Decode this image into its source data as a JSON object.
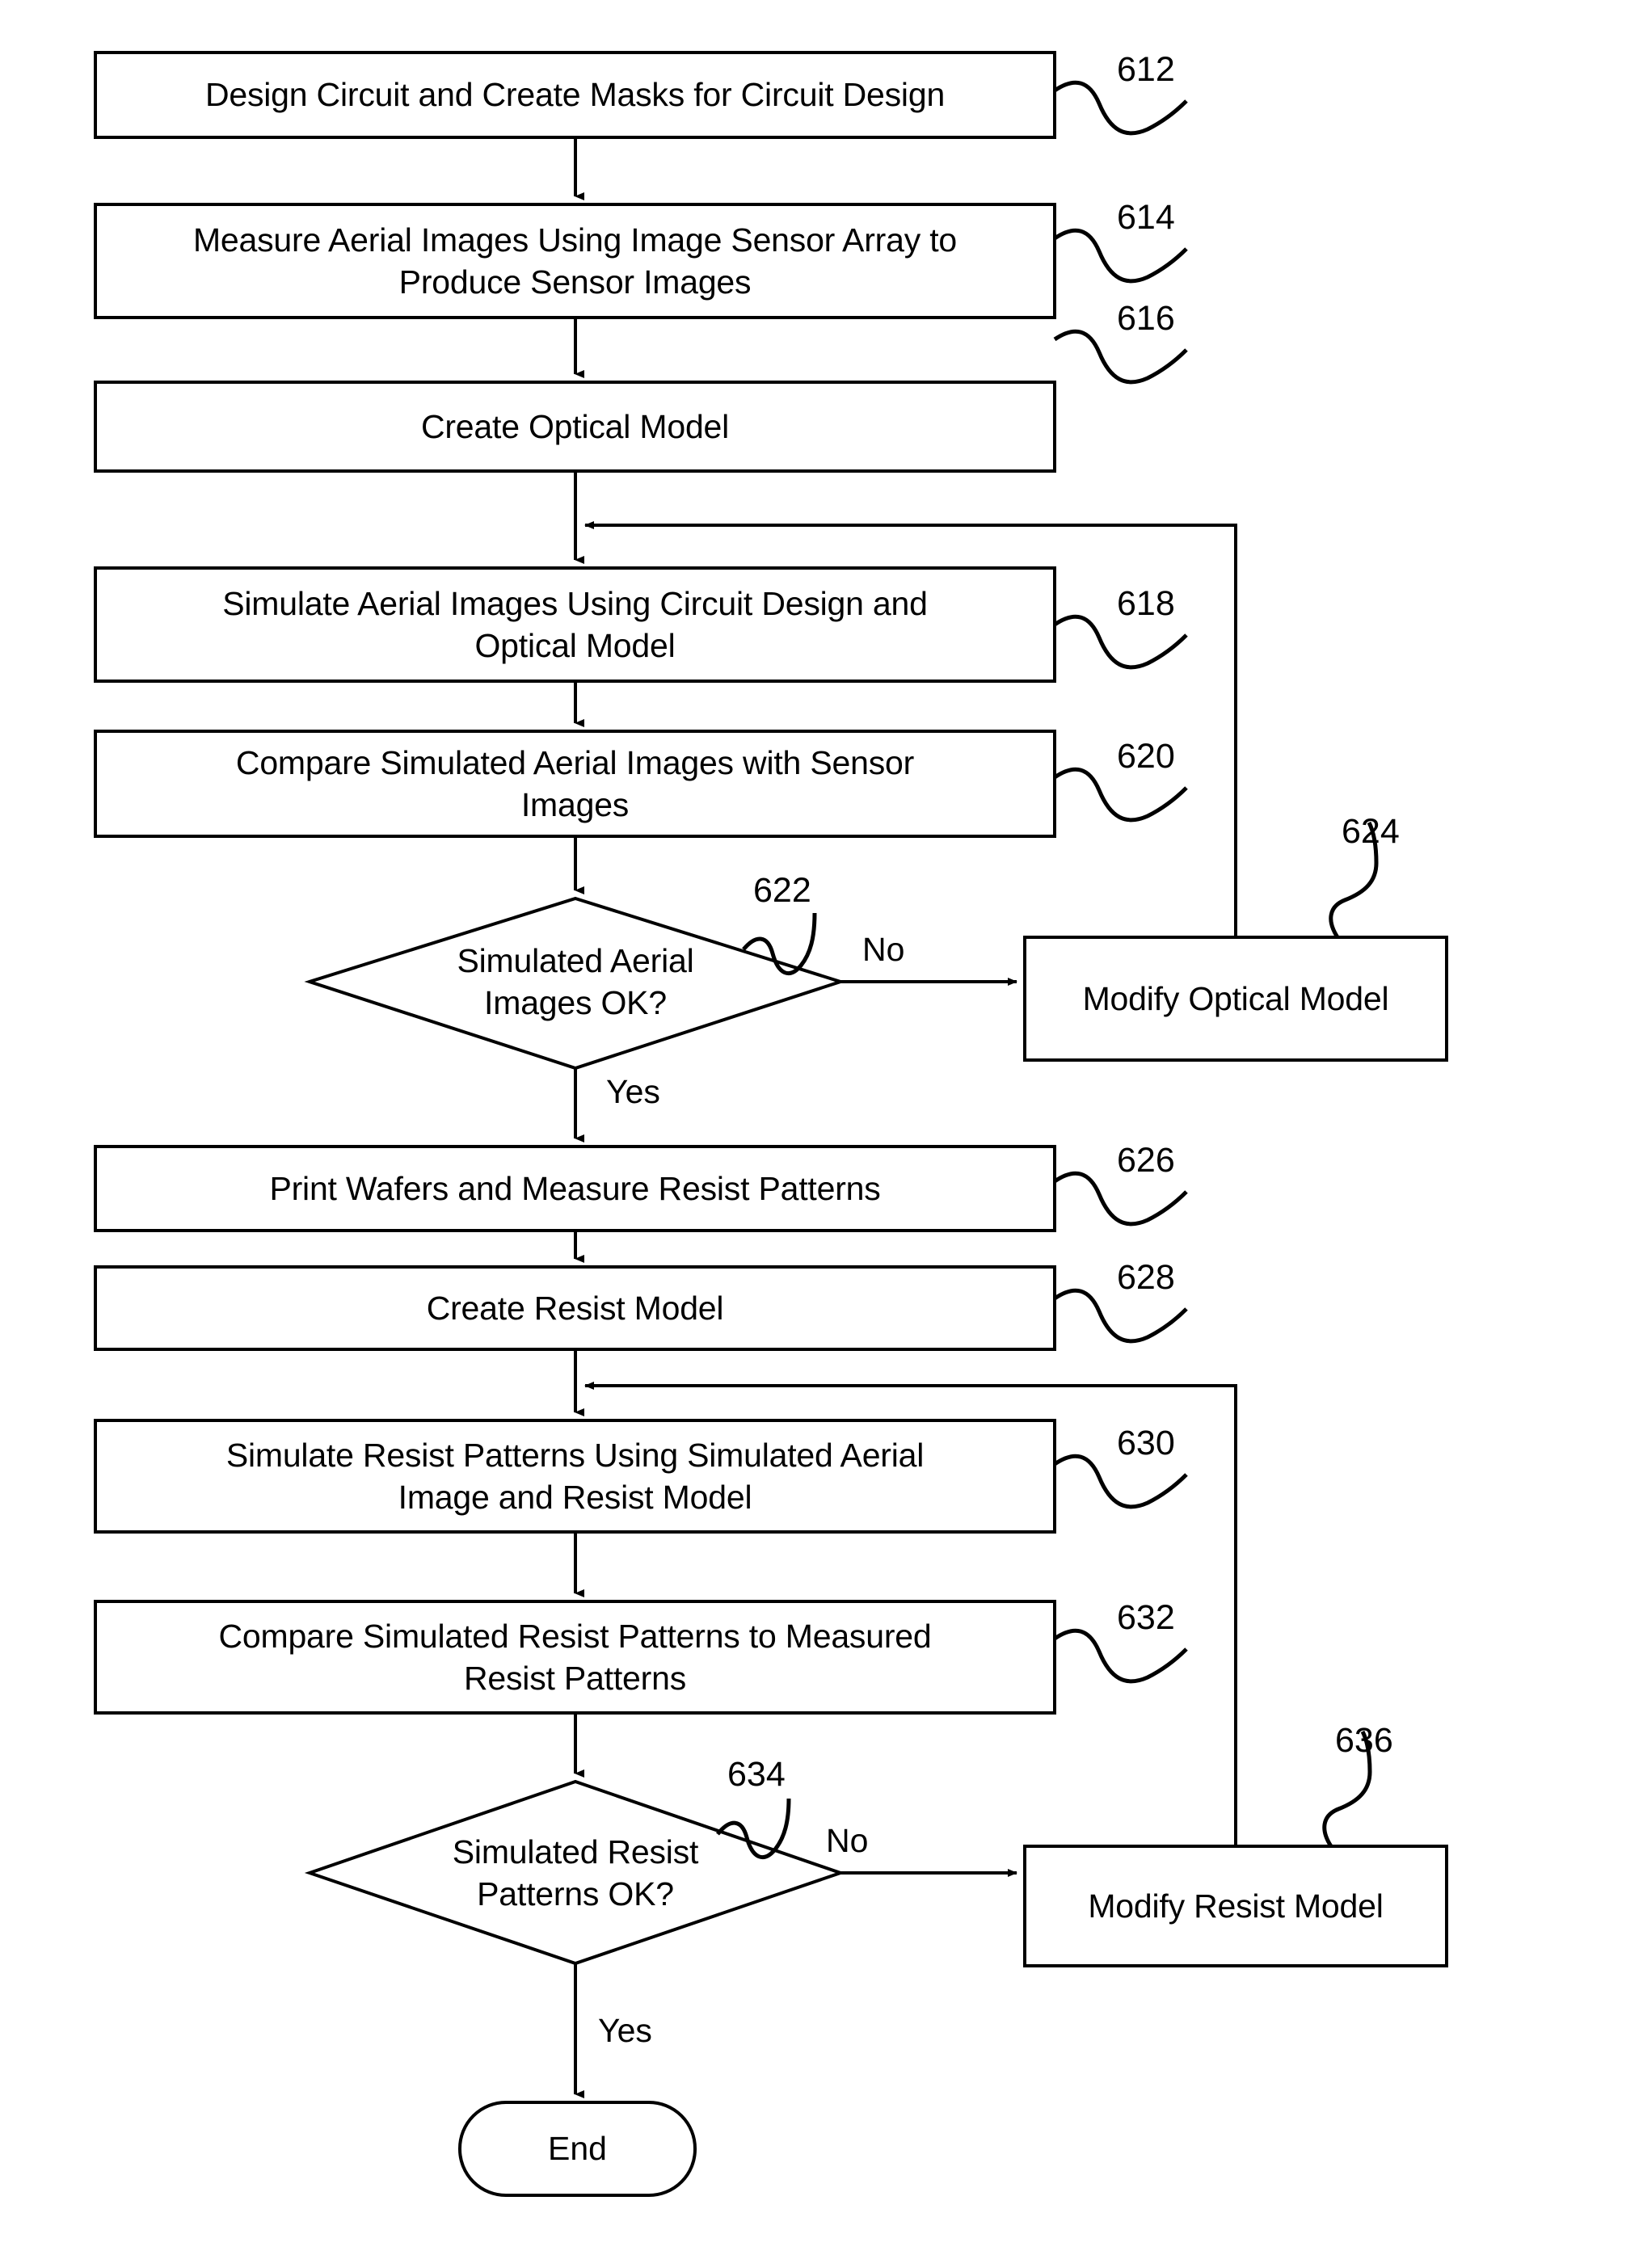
{
  "figure": {
    "type": "flowchart",
    "orientation": "vertical"
  },
  "nodes": [
    {
      "id": "n612",
      "shape": "process",
      "ref": "612",
      "label": "Design Circuit and Create Masks for Circuit Design"
    },
    {
      "id": "n614",
      "shape": "process",
      "ref": "614",
      "label": "Measure Aerial Images Using Image Sensor Array to Produce Sensor Images"
    },
    {
      "id": "n616",
      "shape": "process",
      "ref": "616",
      "label": "Create Optical Model"
    },
    {
      "id": "n618",
      "shape": "process",
      "ref": "618",
      "label": "Simulate Aerial Images Using Circuit Design and Optical Model"
    },
    {
      "id": "n620",
      "shape": "process",
      "ref": "620",
      "label": "Compare Simulated Aerial Images with Sensor Images"
    },
    {
      "id": "n622",
      "shape": "decision",
      "ref": "622",
      "label": "Simulated Aerial Images OK?"
    },
    {
      "id": "n624",
      "shape": "process",
      "ref": "624",
      "label": "Modify Optical Model"
    },
    {
      "id": "n626",
      "shape": "process",
      "ref": "626",
      "label": "Print Wafers and Measure Resist Patterns"
    },
    {
      "id": "n628",
      "shape": "process",
      "ref": "628",
      "label": "Create Resist Model"
    },
    {
      "id": "n630",
      "shape": "process",
      "ref": "630",
      "label": "Simulate Resist Patterns Using Simulated Aerial Image and Resist Model"
    },
    {
      "id": "n632",
      "shape": "process",
      "ref": "632",
      "label": "Compare Simulated Resist Patterns to Measured Resist Patterns"
    },
    {
      "id": "n634",
      "shape": "decision",
      "ref": "634",
      "label": "Simulated Resist Patterns OK?"
    },
    {
      "id": "n636",
      "shape": "process",
      "ref": "636",
      "label": "Modify Resist Model"
    },
    {
      "id": "nEnd",
      "shape": "terminator",
      "ref": "",
      "label": "End"
    }
  ],
  "node_labels": {
    "n612": "Design Circuit and Create Masks for Circuit Design",
    "n614_line1": "Measure Aerial Images Using Image Sensor Array to",
    "n614_line2": "Produce Sensor Images",
    "n616": "Create Optical Model",
    "n618_line1": "Simulate Aerial Images Using Circuit Design and",
    "n618_line2": "Optical Model",
    "n620_line1": "Compare Simulated Aerial Images with Sensor",
    "n620_line2": "Images",
    "n622_line1": "Simulated Aerial",
    "n622_line2": "Images OK?",
    "n624": "Modify Optical Model",
    "n626": "Print Wafers and Measure Resist Patterns",
    "n628": "Create Resist Model",
    "n630_line1": "Simulate Resist Patterns Using Simulated Aerial",
    "n630_line2": "Image and Resist Model",
    "n632_line1": "Compare Simulated Resist Patterns to Measured",
    "n632_line2": "Resist Patterns",
    "n634_line1": "Simulated Resist",
    "n634_line2": "Patterns OK?",
    "n636": "Modify Resist Model",
    "nEnd": "End"
  },
  "refs": {
    "r612": "612",
    "r614": "614",
    "r616": "616",
    "r618": "618",
    "r620": "620",
    "r622": "622",
    "r624": "624",
    "r626": "626",
    "r628": "628",
    "r630": "630",
    "r632": "632",
    "r634": "634",
    "r636": "636"
  },
  "edge_labels": {
    "no_upper": "No",
    "yes_upper": "Yes",
    "no_lower": "No",
    "yes_lower": "Yes"
  },
  "colors": {
    "stroke": "#000000",
    "fill": "#ffffff",
    "text": "#000000"
  }
}
